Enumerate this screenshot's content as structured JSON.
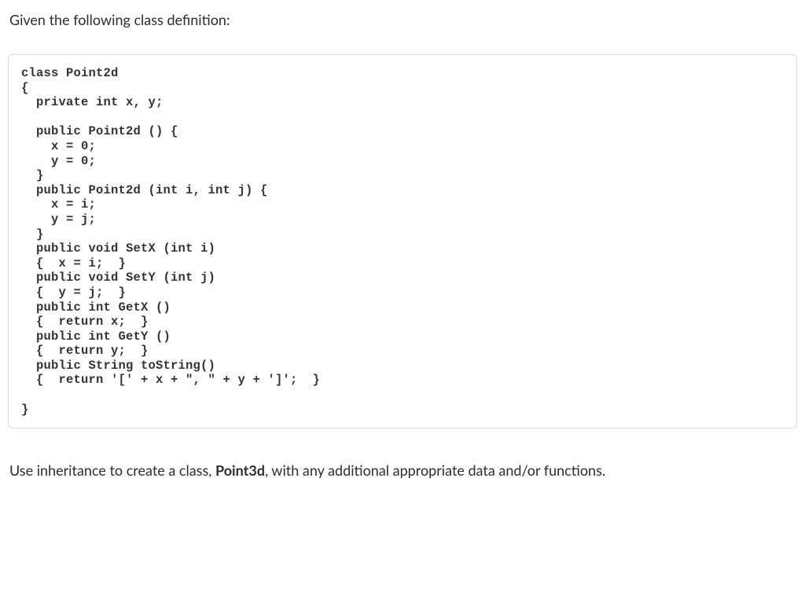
{
  "intro": "Given the following class definition:",
  "code": "class Point2d\n{\n  private int x, y;\n\n  public Point2d () {\n    x = 0;\n    y = 0;\n  }\n  public Point2d (int i, int j) {\n    x = i;\n    y = j;\n  }\n  public void SetX (int i)\n  {  x = i;  }\n  public void SetY (int j)\n  {  y = j;  }\n  public int GetX ()\n  {  return x;  }\n  public int GetY ()\n  {  return y;  }\n  public String toString()\n  {  return '[' + x + \", \" + y + ']';  }\n\n}",
  "outro_prefix": "Use inheritance to create a class, ",
  "outro_bold": "Point3d",
  "outro_suffix": ", with any additional appropriate data and/or functions."
}
